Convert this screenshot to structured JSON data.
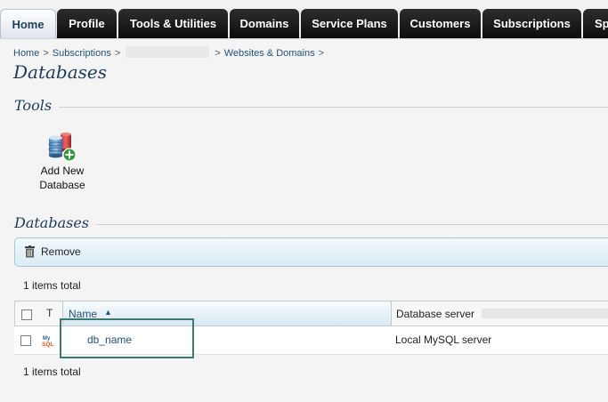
{
  "nav": {
    "tabs": [
      {
        "label": "Home",
        "active": true
      },
      {
        "label": "Profile"
      },
      {
        "label": "Tools & Utilities"
      },
      {
        "label": "Domains"
      },
      {
        "label": "Service Plans"
      },
      {
        "label": "Customers"
      },
      {
        "label": "Subscriptions"
      },
      {
        "label": "Sp"
      }
    ]
  },
  "breadcrumb": {
    "items": [
      "Home",
      "Subscriptions",
      "Websites & Domains"
    ],
    "separator": ">"
  },
  "page": {
    "title": "Databases"
  },
  "tools": {
    "title": "Tools",
    "add_database": {
      "line1": "Add New",
      "line2": "Database",
      "icon": "database-add-icon"
    }
  },
  "databases": {
    "title": "Databases",
    "toolbar": {
      "remove_label": "Remove",
      "remove_icon": "trash-icon"
    },
    "total_top": "1 items total",
    "total_bottom": "1 items total",
    "columns": {
      "type": "T",
      "name": "Name",
      "server": "Database server"
    },
    "rows": [
      {
        "type_icon": "mysql-icon",
        "name": "db_name",
        "server": "Local MySQL server"
      }
    ]
  },
  "colors": {
    "nav_dark": "#1a1a1a",
    "link": "#25507a",
    "heading": "#1d3a57",
    "highlight_border": "#3b7a6e"
  }
}
